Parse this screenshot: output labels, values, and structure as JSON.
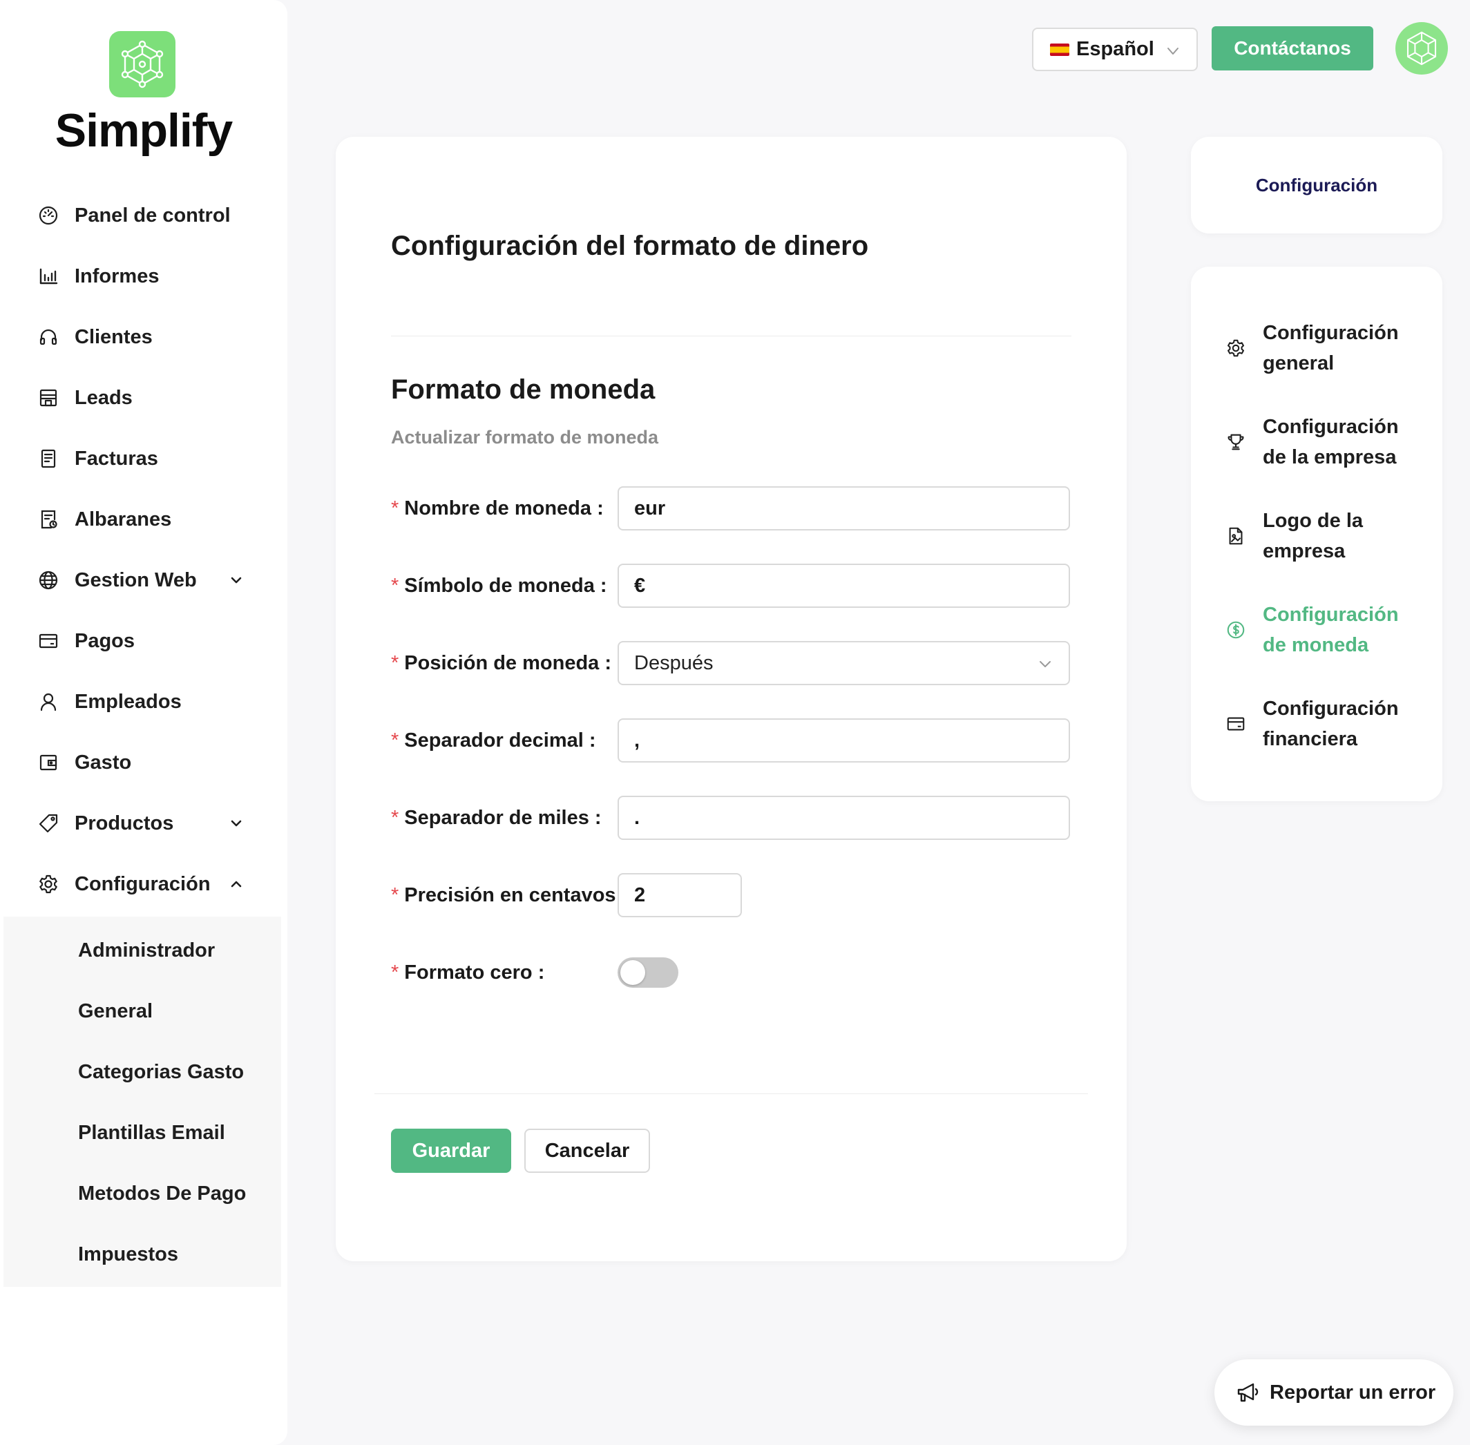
{
  "app": {
    "name": "Simplify"
  },
  "header": {
    "language": {
      "flag_icon": "spain-flag-icon",
      "label": "Español"
    },
    "contact_label": "Contáctanos"
  },
  "sidebar": {
    "items": [
      {
        "label": "Panel de control",
        "icon": "dashboard-icon"
      },
      {
        "label": "Informes",
        "icon": "bar-chart-icon"
      },
      {
        "label": "Clientes",
        "icon": "headphones-icon"
      },
      {
        "label": "Leads",
        "icon": "store-icon"
      },
      {
        "label": "Facturas",
        "icon": "invoice-icon"
      },
      {
        "label": "Albaranes",
        "icon": "delivery-note-icon"
      },
      {
        "label": "Gestion Web",
        "icon": "globe-icon",
        "expandable": true
      },
      {
        "label": "Pagos",
        "icon": "credit-card-icon"
      },
      {
        "label": "Empleados",
        "icon": "user-icon"
      },
      {
        "label": "Gasto",
        "icon": "wallet-icon"
      },
      {
        "label": "Productos",
        "icon": "tag-icon",
        "expandable": true
      },
      {
        "label": "Configuración",
        "icon": "gear-icon",
        "expanded": true
      }
    ],
    "submenu": [
      {
        "label": "Administrador"
      },
      {
        "label": "General"
      },
      {
        "label": "Categorias Gasto"
      },
      {
        "label": "Plantillas Email"
      },
      {
        "label": "Metodos De Pago"
      },
      {
        "label": "Impuestos"
      }
    ]
  },
  "main": {
    "title": "Configuración del formato de dinero",
    "section_title": "Formato de moneda",
    "section_subtitle": "Actualizar formato de moneda",
    "fields": {
      "currency_name": {
        "label": "Nombre de moneda",
        "value": "eur"
      },
      "currency_symbol": {
        "label": "Símbolo de moneda",
        "value": "€"
      },
      "currency_position": {
        "label": "Posición de moneda",
        "value": "Después"
      },
      "decimal_separator": {
        "label": "Separador decimal",
        "value": ","
      },
      "thousand_separator": {
        "label": "Separador de miles",
        "value": "."
      },
      "cent_precision": {
        "label": "Precisión en centavos",
        "value": "2"
      },
      "zero_format": {
        "label": "Formato cero",
        "enabled": false
      }
    },
    "required_marker": "*",
    "label_suffix": ":",
    "save_label": "Guardar",
    "cancel_label": "Cancelar"
  },
  "settings_panel": {
    "title": "Configuración",
    "items": [
      {
        "label": "Configuración general",
        "icon": "gear-icon",
        "active": false
      },
      {
        "label": "Configuración de la empresa",
        "icon": "trophy-icon",
        "active": false
      },
      {
        "label": "Logo de la empresa",
        "icon": "image-file-icon",
        "active": false
      },
      {
        "label": "Configuración de moneda",
        "icon": "dollar-circle-icon",
        "active": true
      },
      {
        "label": "Configuración financiera",
        "icon": "credit-card-icon",
        "active": false
      }
    ]
  },
  "report_button": {
    "label": "Reportar un error",
    "icon": "megaphone-icon"
  },
  "colors": {
    "accent": "#52b883",
    "logo_green": "#7ddf7a",
    "required": "#e5484d",
    "panel_title": "#1b1a55"
  }
}
